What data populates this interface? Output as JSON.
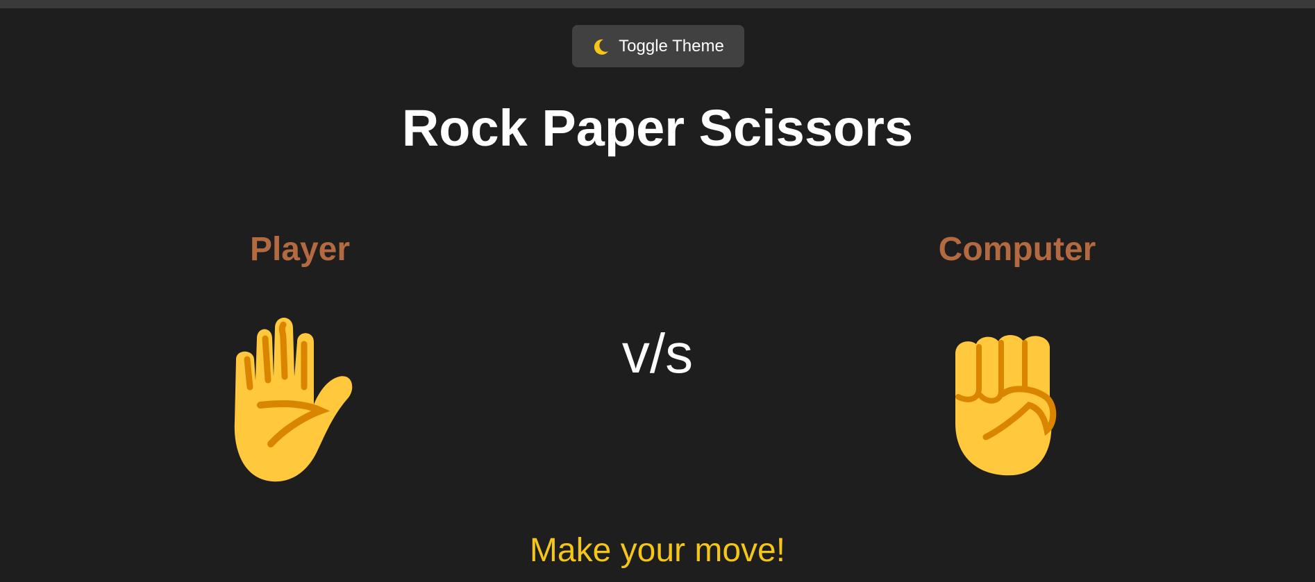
{
  "header": {
    "toggle_theme_label": "Toggle Theme",
    "toggle_theme_icon": "crescent-moon-icon"
  },
  "game": {
    "title": "Rock Paper Scissors",
    "player_label": "Player",
    "computer_label": "Computer",
    "vs_label": "v/s",
    "player_choice": "paper",
    "player_choice_icon": "raised-hand-icon",
    "computer_choice": "rock",
    "computer_choice_icon": "raised-fist-icon",
    "status_message": "Make your move!"
  },
  "colors": {
    "background": "#1e1e1e",
    "button_background": "#414141",
    "label_color": "#b36a40",
    "status_color": "#f5c518",
    "hand_fill": "#ffc83d",
    "hand_shade": "#d98500"
  }
}
